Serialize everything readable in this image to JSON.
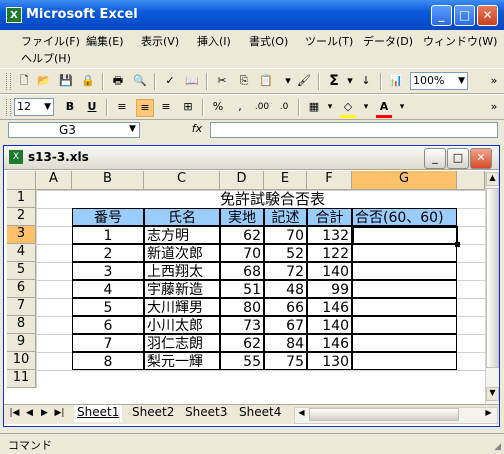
{
  "app": {
    "title": "Microsoft Excel"
  },
  "menu": [
    "ファイル(F)",
    "編集(E)",
    "表示(V)",
    "挿入(I)",
    "書式(O)",
    "ツール(T)",
    "データ(D)",
    "ウィンドウ(W)",
    "ヘルプ(H)"
  ],
  "toolbar": {
    "zoom": "100%",
    "font_size": "12"
  },
  "formula": {
    "name_box": "G3",
    "fx": "fx",
    "value": ""
  },
  "workbook": {
    "title": "s13-3.xls",
    "columns": [
      "A",
      "B",
      "C",
      "D",
      "E",
      "F",
      "G"
    ],
    "rows": [
      "1",
      "2",
      "3",
      "4",
      "5",
      "6",
      "7",
      "8",
      "9",
      "10",
      "11"
    ],
    "sheet_title": "免許試験合否表",
    "headers": [
      "番号",
      "氏名",
      "実地",
      "記述",
      "合計",
      "合否(60、60)"
    ],
    "data": [
      [
        "1",
        "志方明",
        "62",
        "70",
        "132"
      ],
      [
        "2",
        "新道次郎",
        "70",
        "52",
        "122"
      ],
      [
        "3",
        "上西翔太",
        "68",
        "72",
        "140"
      ],
      [
        "4",
        "宇藤新造",
        "51",
        "48",
        "99"
      ],
      [
        "5",
        "大川輝男",
        "80",
        "66",
        "146"
      ],
      [
        "6",
        "小川太郎",
        "73",
        "67",
        "140"
      ],
      [
        "7",
        "羽仁志朗",
        "62",
        "84",
        "146"
      ],
      [
        "8",
        "梨元一輝",
        "55",
        "75",
        "130"
      ]
    ],
    "tabs": [
      "Sheet1",
      "Sheet2",
      "Sheet3",
      "Sheet4"
    ]
  },
  "status": {
    "mode": "コマンド"
  },
  "colors": {
    "header_fill": "#99ccff",
    "selected_header": "#ffc06a"
  }
}
